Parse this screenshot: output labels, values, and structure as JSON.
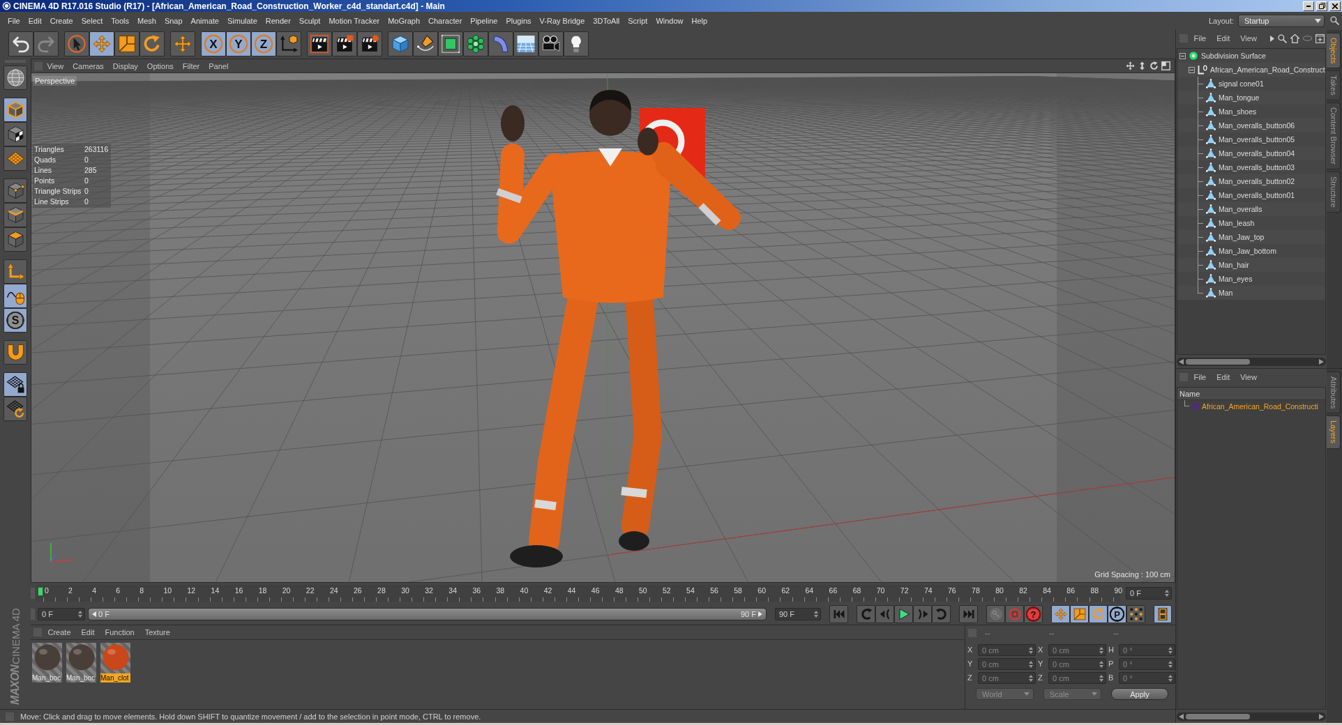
{
  "window": {
    "title": "CINEMA 4D R17.016 Studio (R17) - [African_American_Road_Construction_Worker_c4d_standart.c4d] - Main"
  },
  "menu_bar": {
    "items": [
      "File",
      "Edit",
      "Create",
      "Select",
      "Tools",
      "Mesh",
      "Snap",
      "Animate",
      "Simulate",
      "Render",
      "Sculpt",
      "Motion Tracker",
      "MoGraph",
      "Character",
      "Pipeline",
      "Plugins",
      "V-Ray Bridge",
      "3DToAll",
      "Script",
      "Window",
      "Help"
    ],
    "layout_label": "Layout:",
    "layout_value": "Startup"
  },
  "toolbar": {
    "groups": [
      [
        {
          "kind": "undo",
          "on": false,
          "disabled": false
        },
        {
          "kind": "redo",
          "on": false,
          "disabled": true
        }
      ],
      [
        {
          "kind": "select",
          "on": false,
          "disabled": false
        },
        {
          "kind": "move",
          "on": true,
          "disabled": false
        },
        {
          "kind": "scale",
          "on": false,
          "disabled": false
        },
        {
          "kind": "rotate",
          "on": false,
          "disabled": false
        }
      ],
      [
        {
          "kind": "recent",
          "on": false,
          "disabled": false
        }
      ],
      [
        {
          "kind": "axis",
          "label": "X",
          "on": true,
          "disabled": false
        },
        {
          "kind": "axis",
          "label": "Y",
          "on": true,
          "disabled": false
        },
        {
          "kind": "axis",
          "label": "Z",
          "on": true,
          "disabled": false
        },
        {
          "kind": "coords",
          "on": false,
          "disabled": false
        }
      ],
      [
        {
          "kind": "renderview",
          "on": false,
          "disabled": false
        },
        {
          "kind": "renderpicture",
          "on": false,
          "disabled": false
        },
        {
          "kind": "rendersettings",
          "on": false,
          "disabled": false
        }
      ],
      [
        {
          "kind": "cube",
          "on": false,
          "disabled": false
        },
        {
          "kind": "pen",
          "on": false,
          "disabled": false
        },
        {
          "kind": "subdivision",
          "on": false,
          "disabled": false
        },
        {
          "kind": "cloner",
          "on": false,
          "disabled": false
        },
        {
          "kind": "bend",
          "on": false,
          "disabled": false
        },
        {
          "kind": "floor",
          "on": false,
          "disabled": false
        },
        {
          "kind": "camera",
          "on": false,
          "disabled": false
        },
        {
          "kind": "light",
          "on": false,
          "disabled": false
        }
      ]
    ]
  },
  "mode_toolbar": {
    "groups": [
      [
        {
          "kind": "globe",
          "on": false
        }
      ],
      [
        {
          "kind": "model",
          "on": true
        },
        {
          "kind": "texture",
          "on": false
        },
        {
          "kind": "workplane",
          "on": false
        }
      ],
      [
        {
          "kind": "points",
          "on": false
        },
        {
          "kind": "edges",
          "on": false
        },
        {
          "kind": "polygons",
          "on": false
        }
      ],
      [
        {
          "kind": "axismode",
          "on": false
        },
        {
          "kind": "tweak",
          "on": true
        },
        {
          "kind": "solo",
          "label": "S",
          "on": true
        }
      ],
      [
        {
          "kind": "magnet",
          "on": false
        }
      ],
      [
        {
          "kind": "gridlock",
          "on": true
        },
        {
          "kind": "gridrotate",
          "on": false
        }
      ]
    ]
  },
  "viewport": {
    "menu": [
      "View",
      "Cameras",
      "Display",
      "Options",
      "Filter",
      "Panel"
    ],
    "camera": "Perspective",
    "stats": [
      {
        "label": "Triangles",
        "value": "263116"
      },
      {
        "label": "Quads",
        "value": "0"
      },
      {
        "label": "Lines",
        "value": "285"
      },
      {
        "label": "Points",
        "value": "0"
      },
      {
        "label": "Triangle Strips",
        "value": "0"
      },
      {
        "label": "Line Strips",
        "value": "0"
      }
    ],
    "grid_spacing": "Grid Spacing : 100 cm"
  },
  "objects": {
    "menu": [
      "File",
      "Edit",
      "View"
    ],
    "tree": [
      {
        "name": "Subdivision Surface",
        "kind": "subdivision",
        "expanded": true,
        "children": [
          {
            "name": "African_American_Road_Construct",
            "kind": "null",
            "expanded": true,
            "children": [
              {
                "name": "signal cone01",
                "kind": "polygon"
              },
              {
                "name": "Man_tongue",
                "kind": "polygon"
              },
              {
                "name": "Man_shoes",
                "kind": "polygon"
              },
              {
                "name": "Man_overalls_button06",
                "kind": "polygon"
              },
              {
                "name": "Man_overalls_button05",
                "kind": "polygon"
              },
              {
                "name": "Man_overalls_button04",
                "kind": "polygon"
              },
              {
                "name": "Man_overalls_button03",
                "kind": "polygon"
              },
              {
                "name": "Man_overalls_button02",
                "kind": "polygon"
              },
              {
                "name": "Man_overalls_button01",
                "kind": "polygon"
              },
              {
                "name": "Man_overalls",
                "kind": "polygon"
              },
              {
                "name": "Man_leash",
                "kind": "polygon"
              },
              {
                "name": "Man_Jaw_top",
                "kind": "polygon"
              },
              {
                "name": "Man_Jaw_bottom",
                "kind": "polygon"
              },
              {
                "name": "Man_hair",
                "kind": "polygon"
              },
              {
                "name": "Man_eyes",
                "kind": "polygon"
              },
              {
                "name": "Man",
                "kind": "polygon"
              }
            ]
          }
        ]
      }
    ]
  },
  "side_tabs_upper": [
    {
      "label": "Objects",
      "selected": true
    },
    {
      "label": "Takes",
      "selected": false
    },
    {
      "label": "Content Browser",
      "selected": false
    },
    {
      "label": "Structure",
      "selected": false
    }
  ],
  "layers": {
    "menu": [
      "File",
      "Edit",
      "View"
    ],
    "header": "Name",
    "rows": [
      {
        "name": "African_American_Road_Constructi",
        "color": "#4b2f6e",
        "selected": true
      }
    ]
  },
  "side_tabs_lower": [
    {
      "label": "Attributes",
      "selected": false
    },
    {
      "label": "Layers",
      "selected": true
    }
  ],
  "timeline": {
    "ticks": [
      "0",
      "2",
      "4",
      "6",
      "8",
      "10",
      "12",
      "14",
      "16",
      "18",
      "20",
      "22",
      "24",
      "26",
      "28",
      "30",
      "32",
      "34",
      "36",
      "38",
      "40",
      "42",
      "44",
      "46",
      "48",
      "50",
      "52",
      "54",
      "56",
      "58",
      "60",
      "62",
      "64",
      "66",
      "68",
      "70",
      "72",
      "74",
      "76",
      "78",
      "80",
      "82",
      "84",
      "86",
      "88",
      "90"
    ],
    "level": 0,
    "frame": "0 F"
  },
  "playback": {
    "start_field": "0 F",
    "range": {
      "start": "0 F",
      "end": "90 F",
      "level": 1
    },
    "end_field": "90 F",
    "transport": [
      {
        "kind": "first"
      },
      {
        "kind": "prevkey"
      },
      {
        "kind": "prevframe"
      },
      {
        "kind": "play"
      },
      {
        "kind": "nextframe"
      },
      {
        "kind": "nextkey"
      },
      {
        "kind": "last"
      }
    ],
    "keys": [
      {
        "kind": "recordkeys",
        "on": false,
        "disabled": true
      },
      {
        "kind": "autokey",
        "on": false,
        "disabled": false
      },
      {
        "kind": "keyselection",
        "label": "?",
        "on": false,
        "disabled": false
      }
    ],
    "tracks": [
      {
        "kind": "position",
        "on": true
      },
      {
        "kind": "scaletrack",
        "on": true
      },
      {
        "kind": "rotation",
        "on": true
      },
      {
        "kind": "parameter",
        "label": "P",
        "on": true
      },
      {
        "kind": "pla",
        "on": false
      }
    ],
    "timeline_button": {
      "on": true
    }
  },
  "materials": {
    "menu": [
      "Create",
      "Edit",
      "Function",
      "Texture"
    ],
    "items": [
      {
        "name": "Man_boc",
        "color": "#4a3e38",
        "selected": false
      },
      {
        "name": "Man_boc",
        "color": "#4a3e38",
        "selected": false
      },
      {
        "name": "Man_clot",
        "color": "#c9471a",
        "selected": true
      }
    ]
  },
  "coordinates": {
    "headers": [
      "--",
      "--",
      "--"
    ],
    "rows": [
      [
        {
          "axis": "X",
          "value": "0 cm"
        },
        {
          "axis": "X",
          "value": "0 cm"
        },
        {
          "axis": "H",
          "value": "0 °"
        }
      ],
      [
        {
          "axis": "Y",
          "value": "0 cm"
        },
        {
          "axis": "Y",
          "value": "0 cm"
        },
        {
          "axis": "P",
          "value": "0 °"
        }
      ],
      [
        {
          "axis": "Z",
          "value": "0 cm"
        },
        {
          "axis": "Z",
          "value": "0 cm"
        },
        {
          "axis": "B",
          "value": "0 °"
        }
      ]
    ],
    "disabled": true,
    "dropdowns": [
      "World",
      "Scale"
    ],
    "apply": "Apply"
  },
  "logo": {
    "brand": "MAXON",
    "product": "CINEMA 4D"
  },
  "status_bar": {
    "text": "Move: Click and drag to move elements. Hold down SHIFT to quantize movement / add to the selection in point mode, CTRL to remove."
  }
}
